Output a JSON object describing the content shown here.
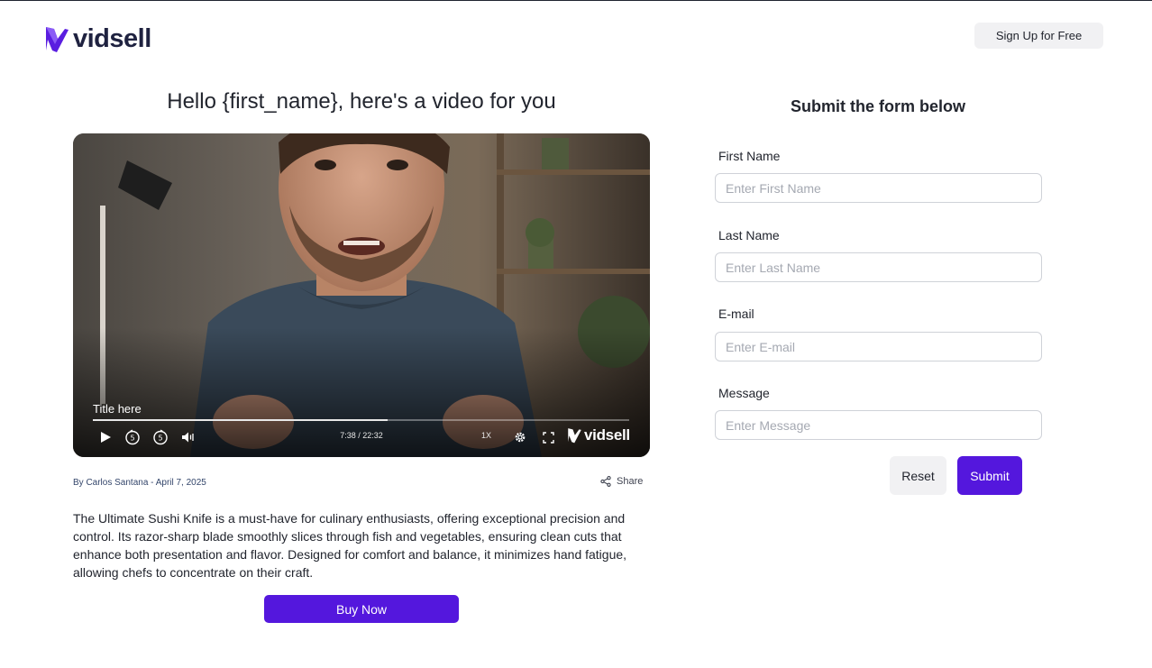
{
  "header": {
    "brand": "vidsell",
    "signup_label": "Sign Up for Free"
  },
  "video": {
    "heading": "Hello {first_name}, here's a video for you",
    "title": "Title here",
    "time": "7:38 / 22:32",
    "speed": "1X",
    "progress": 0.55,
    "player_brand": "vidsell",
    "icons": [
      "play-icon",
      "rewind-5-icon",
      "forward-5-icon",
      "volume-icon",
      "settings-icon",
      "fullscreen-icon"
    ]
  },
  "meta": {
    "byline": "By Carlos Santana - April 7, 2025",
    "share_label": "Share"
  },
  "description": "The Ultimate Sushi Knife is a must-have for culinary enthusiasts, offering exceptional precision and control. Its razor-sharp blade smoothly slices through fish and vegetables, ensuring clean cuts that enhance both presentation and flavor. Designed for comfort and balance, it minimizes hand fatigue, allowing chefs to concentrate on their craft.",
  "buy_label": "Buy Now",
  "form": {
    "title": "Submit the form below",
    "fields": [
      {
        "label": "First Name",
        "placeholder": "Enter First Name",
        "value": ""
      },
      {
        "label": "Last Name",
        "placeholder": "Enter Last Name",
        "value": ""
      },
      {
        "label": "E-mail",
        "placeholder": "Enter E-mail",
        "value": ""
      },
      {
        "label": "Message",
        "placeholder": "Enter Message",
        "value": ""
      }
    ],
    "reset_label": "Reset",
    "submit_label": "Submit"
  },
  "colors": {
    "accent": "#5417dd",
    "brand_text": "#1f2240",
    "button_gray": "#f1f1f3"
  }
}
